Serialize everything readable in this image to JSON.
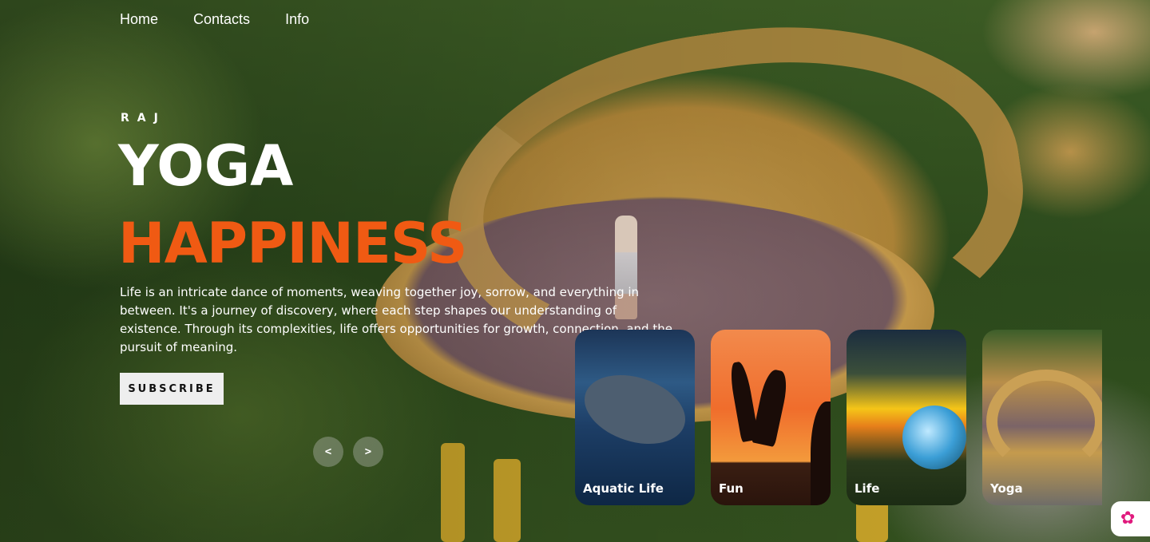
{
  "nav": {
    "items": [
      "Home",
      "Contacts",
      "Info"
    ]
  },
  "hero": {
    "brand": "RAJ",
    "title": "YOGA",
    "topic": "HAPPINESS",
    "description": "Life is an intricate dance of moments, weaving together joy, sorrow, and everything in between. It's a journey of discovery, where each step shapes our understanding of existence. Through its complexities, life offers opportunities for growth, connection, and the pursuit of meaning.",
    "subscribe_label": "SUBSCRIBE"
  },
  "slider": {
    "prev_label": "<",
    "next_label": ">"
  },
  "thumbnails": [
    {
      "label": "Aquatic Life"
    },
    {
      "label": "Fun"
    },
    {
      "label": "Life"
    },
    {
      "label": "Yoga"
    }
  ],
  "colors": {
    "accent": "#f05a13",
    "text": "#ffffff",
    "button_bg": "#eeeeee"
  },
  "icons": {
    "corner_widget": "brain-icon"
  }
}
